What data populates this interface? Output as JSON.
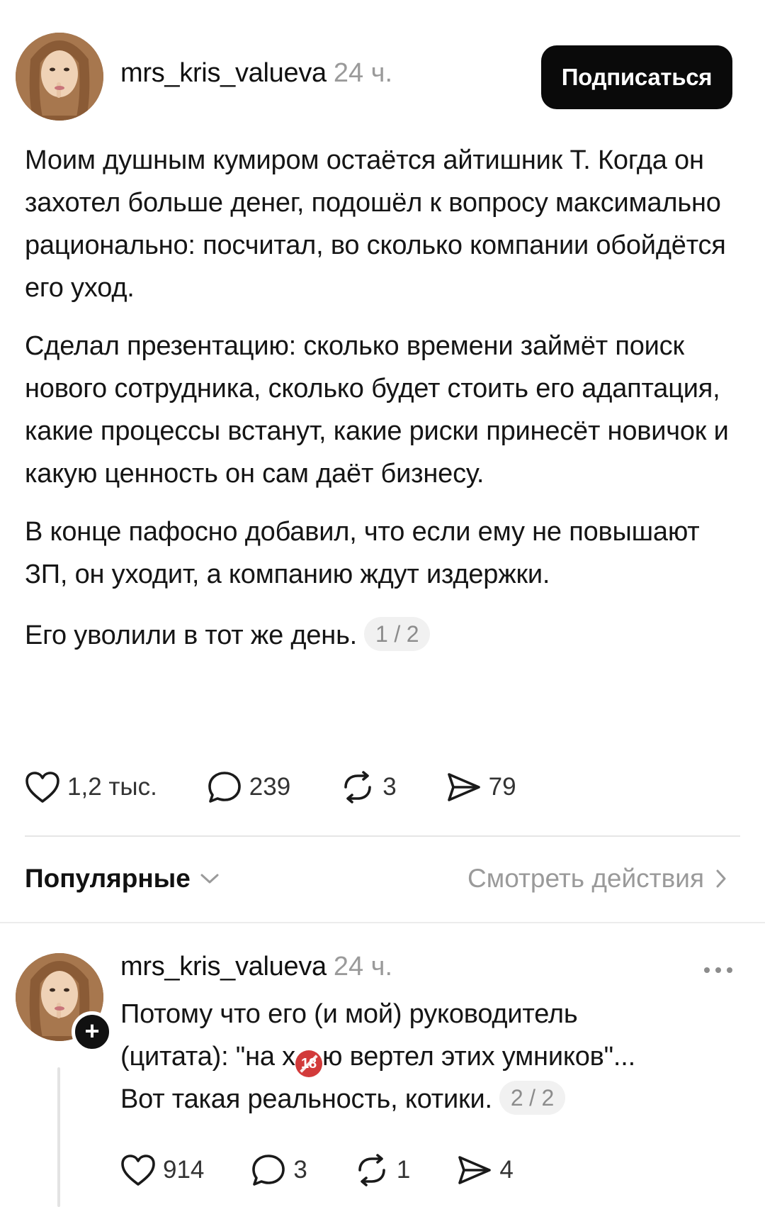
{
  "post": {
    "username": "mrs_kris_valueva",
    "time": "24 ч.",
    "follow_label": "Подписаться",
    "paragraphs": [
      "Моим душным кумиром остаётся айтишник Т. Когда он захотел больше денег, подошёл к вопросу максимально рационально: посчитал, во сколько компании обойдётся его уход.",
      "Сделал презентацию: сколько времени займёт поиск нового сотрудника, сколько будет стоить его адаптация, какие процессы встанут, какие риски принесёт новичок и какую ценность он сам даёт бизнесу.",
      "В конце пафосно добавил, что если ему не повышают ЗП, он уходит, а компанию ждут издержки.",
      "Его уволили в тот же день."
    ],
    "page_counter": "1 / 2",
    "likes": "1,2 тыс.",
    "comments": "239",
    "reposts": "3",
    "shares": "79"
  },
  "replies_header": {
    "sort_label": "Популярные",
    "activity_link": "Смотреть действия"
  },
  "reply": {
    "username": "mrs_kris_valueva",
    "time": "24 ч.",
    "line1": "Потому что его (и мой) руководитель",
    "line2_before": "(цитата): \"на х",
    "emoji_text": "18",
    "line2_after": "ю вертел этих умников\"...",
    "line3": "Вот такая реальность, котики.",
    "page_counter": "2 / 2",
    "likes": "914",
    "comments": "3",
    "reposts": "1",
    "shares": "4"
  }
}
